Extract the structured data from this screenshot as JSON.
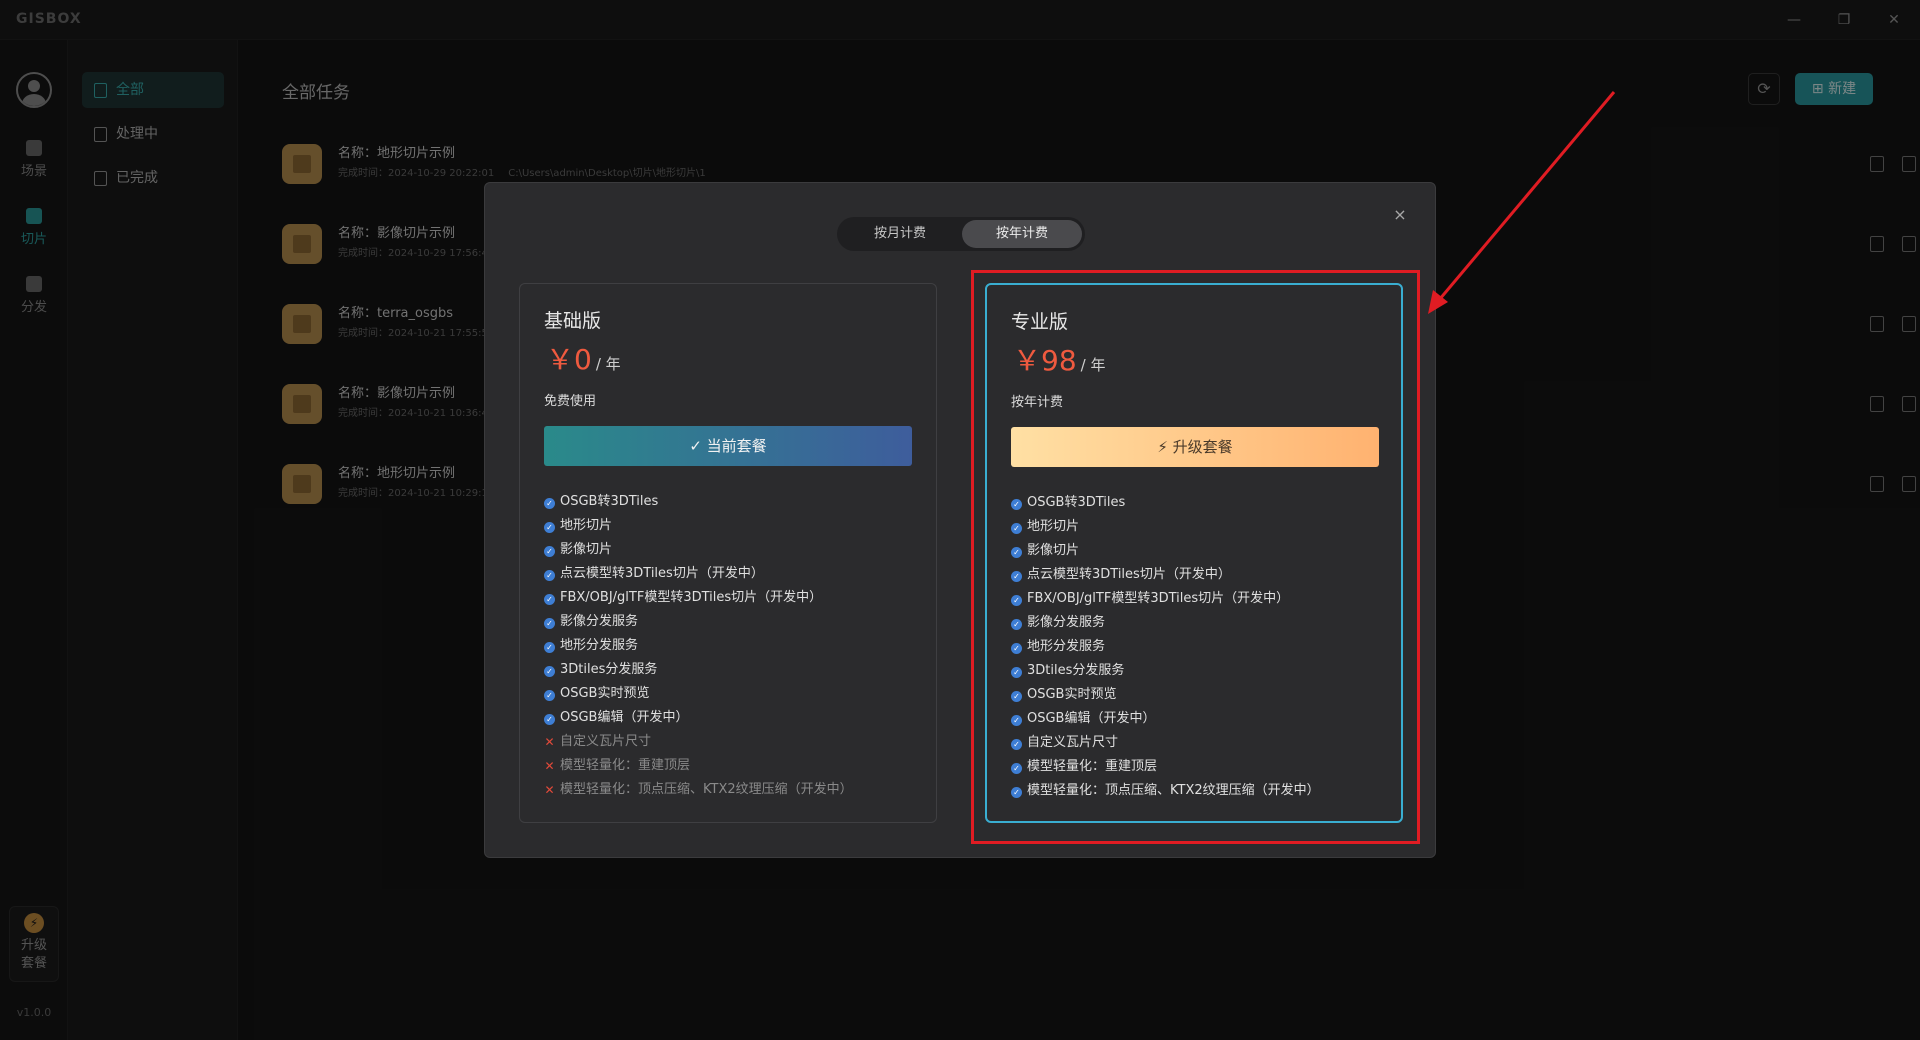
{
  "app": {
    "logo": "GISBOX"
  },
  "window": {
    "minimize": "—",
    "restore": "❐",
    "close": "✕"
  },
  "rail": {
    "items": [
      {
        "label": "场景"
      },
      {
        "label": "切片"
      },
      {
        "label": "分发"
      }
    ],
    "upgrade": {
      "line1": "升级",
      "line2": "套餐"
    },
    "version": "v1.0.0"
  },
  "subsidebar": {
    "items": [
      {
        "label": "全部"
      },
      {
        "label": "处理中"
      },
      {
        "label": "已完成"
      }
    ]
  },
  "main": {
    "title": "全部任务",
    "new_button": "新建",
    "refresh_icon": "⟳",
    "tasks": [
      {
        "name": "名称：地形切片示例",
        "time": "完成时间：2024-10-29 20:22:01",
        "path": "C:\\Users\\admin\\Desktop\\切片\\地形切片\\1"
      },
      {
        "name": "名称：影像切片示例",
        "time": "完成时间：2024-10-29 17:56:4",
        "path": ""
      },
      {
        "name": "名称：terra_osgbs",
        "time": "完成时间：2024-10-21 17:55:5",
        "path": ""
      },
      {
        "name": "名称：影像切片示例",
        "time": "完成时间：2024-10-21 10:36:4",
        "path": ""
      },
      {
        "name": "名称：地形切片示例",
        "time": "完成时间：2024-10-21 10:29:1",
        "path": ""
      }
    ]
  },
  "modal": {
    "close": "×",
    "tabs": [
      {
        "label": "按月计费",
        "active": false
      },
      {
        "label": "按年计费",
        "active": true
      }
    ],
    "plans": [
      {
        "title": "基础版",
        "currency": "￥",
        "price": "0",
        "period": "/ 年",
        "subtitle": "免费使用",
        "cta": "✓ 当前套餐",
        "features": [
          {
            "text": "OSGB转3DTiles",
            "ok": true
          },
          {
            "text": "地形切片",
            "ok": true
          },
          {
            "text": "影像切片",
            "ok": true
          },
          {
            "text": "点云模型转3DTiles切片（开发中）",
            "ok": true
          },
          {
            "text": "FBX/OBJ/glTF模型转3DTiles切片（开发中）",
            "ok": true
          },
          {
            "text": "影像分发服务",
            "ok": true
          },
          {
            "text": "地形分发服务",
            "ok": true
          },
          {
            "text": "3Dtiles分发服务",
            "ok": true
          },
          {
            "text": "OSGB实时预览",
            "ok": true
          },
          {
            "text": "OSGB编辑（开发中）",
            "ok": true
          },
          {
            "text": "自定义瓦片尺寸",
            "ok": false
          },
          {
            "text": "模型轻量化：重建顶层",
            "ok": false
          },
          {
            "text": "模型轻量化：顶点压缩、KTX2纹理压缩（开发中）",
            "ok": false
          }
        ]
      },
      {
        "title": "专业版",
        "currency": "￥",
        "price": "98",
        "period": "/ 年",
        "subtitle": "按年计费",
        "cta": "⚡ 升级套餐",
        "features": [
          {
            "text": "OSGB转3DTiles",
            "ok": true
          },
          {
            "text": "地形切片",
            "ok": true
          },
          {
            "text": "影像切片",
            "ok": true
          },
          {
            "text": "点云模型转3DTiles切片（开发中）",
            "ok": true
          },
          {
            "text": "FBX/OBJ/glTF模型转3DTiles切片（开发中）",
            "ok": true
          },
          {
            "text": "影像分发服务",
            "ok": true
          },
          {
            "text": "地形分发服务",
            "ok": true
          },
          {
            "text": "3Dtiles分发服务",
            "ok": true
          },
          {
            "text": "OSGB实时预览",
            "ok": true
          },
          {
            "text": "OSGB编辑（开发中）",
            "ok": true
          },
          {
            "text": "自定义瓦片尺寸",
            "ok": true
          },
          {
            "text": "模型轻量化：重建顶层",
            "ok": true
          },
          {
            "text": "模型轻量化：顶点压缩、KTX2纹理压缩（开发中）",
            "ok": true
          }
        ]
      }
    ]
  },
  "colors": {
    "accent": "#2a9aa0",
    "price": "#ef5a3f",
    "annotation": "#e01c23",
    "pro_border": "#3aaed1"
  }
}
